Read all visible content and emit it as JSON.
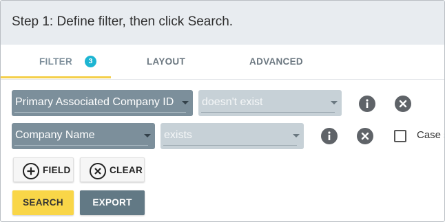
{
  "header": {
    "title": "Step 1: Define filter, then click Search."
  },
  "tabs": [
    {
      "label": "FILTER",
      "badge": "3",
      "active": true
    },
    {
      "label": "LAYOUT"
    },
    {
      "label": "ADVANCED"
    }
  ],
  "filters": [
    {
      "field": "Primary Associated Company ID",
      "operator": "doesn't exist"
    },
    {
      "field": "Company Name",
      "operator": "exists",
      "case_label": "Case s"
    }
  ],
  "buttons": {
    "add_field": "FIELD",
    "clear": "CLEAR",
    "search": "SEARCH",
    "export": "EXPORT"
  },
  "colors": {
    "accent_yellow": "#f9d648",
    "badge": "#1db5d2",
    "field_select": "#7c8f9b",
    "operator_select": "#c7d1d7",
    "export_button": "#627985"
  },
  "icons": [
    "info-icon",
    "remove-circle-icon",
    "plus-circle-icon",
    "clear-circle-icon",
    "chevron-down-icon"
  ]
}
